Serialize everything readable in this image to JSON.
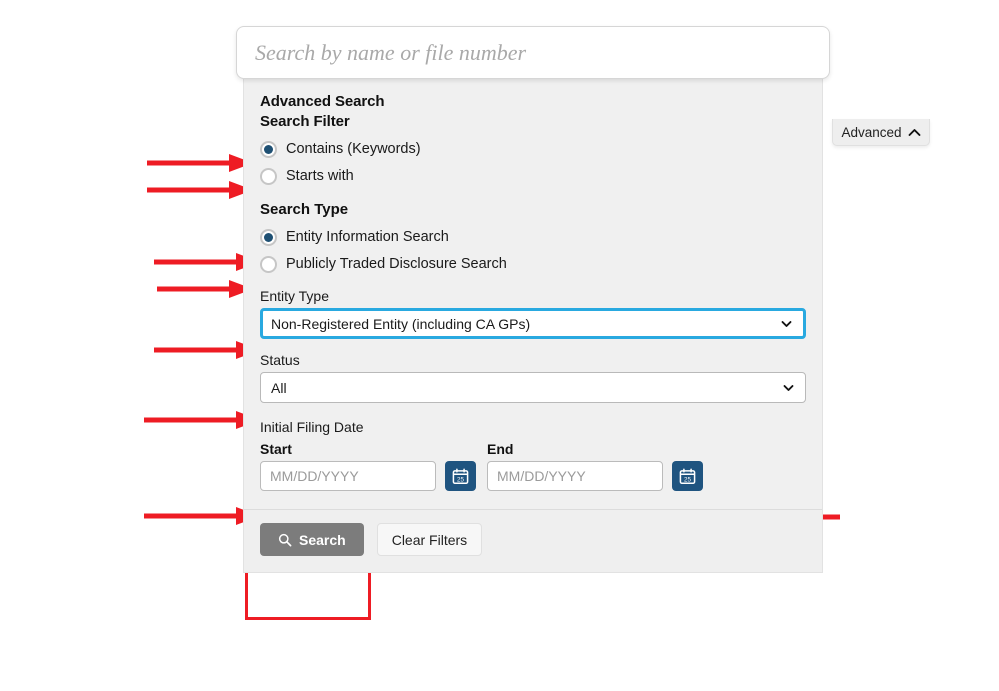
{
  "search": {
    "placeholder": "Search by name or file number",
    "value": ""
  },
  "panel": {
    "title": "Advanced Search",
    "search_filter_heading": "Search Filter",
    "search_type_heading": "Search Type",
    "filter_options": [
      {
        "label": "Contains (Keywords)",
        "selected": true
      },
      {
        "label": "Starts with",
        "selected": false
      }
    ],
    "type_options": [
      {
        "label": "Entity Information Search",
        "selected": true
      },
      {
        "label": "Publicly Traded Disclosure Search",
        "selected": false
      }
    ],
    "entity_type": {
      "label": "Entity Type",
      "value": "Non-Registered Entity (including CA GPs)",
      "focused": true
    },
    "status": {
      "label": "Status",
      "value": "All",
      "focused": false
    },
    "filing_date": {
      "section_label": "Initial Filing Date",
      "start_label": "Start",
      "end_label": "End",
      "start_placeholder": "MM/DD/YYYY",
      "end_placeholder": "MM/DD/YYYY",
      "start_value": "",
      "end_value": "",
      "calendar_icon": "calendar-icon",
      "calendar_day": "25"
    },
    "footer": {
      "search_label": "Search",
      "search_icon": "magnifier-icon",
      "clear_label": "Clear Filters"
    },
    "advanced_toggle": {
      "label": "Advanced",
      "icon": "chevron-up-icon"
    }
  },
  "colors": {
    "accent_blue": "#1f5480",
    "focus_cyan": "#29a9e0",
    "annotation_red": "#ee1c24",
    "search_button_gray": "#7c7c7c",
    "panel_background": "#f0f0f0"
  },
  "annotations": {
    "arrow_count": 7,
    "highlight_label": "Search"
  }
}
